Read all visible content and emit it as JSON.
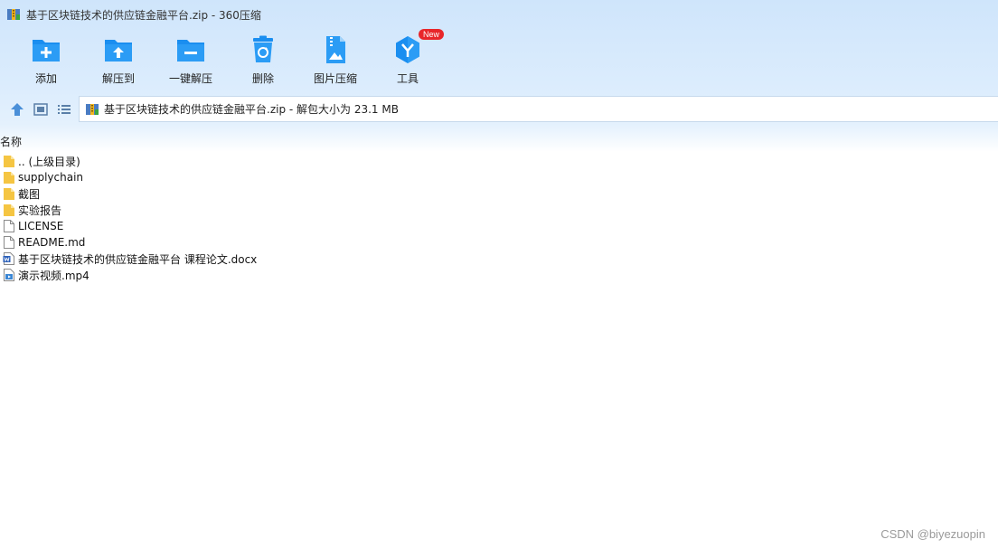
{
  "window": {
    "title": "基于区块链技术的供应链金融平台.zip - 360压缩"
  },
  "toolbar": {
    "items": [
      {
        "id": "add",
        "label": "添加",
        "icon": "folder-plus-icon"
      },
      {
        "id": "extract-to",
        "label": "解压到",
        "icon": "folder-upload-icon"
      },
      {
        "id": "one-click-extract",
        "label": "一键解压",
        "icon": "folder-minus-icon"
      },
      {
        "id": "delete",
        "label": "删除",
        "icon": "recycle-bin-icon"
      },
      {
        "id": "image-compress",
        "label": "图片压缩",
        "icon": "image-zip-icon"
      },
      {
        "id": "tools",
        "label": "工具",
        "icon": "hexagon-tools-icon",
        "badge": "New"
      }
    ]
  },
  "pathbar": {
    "text": "基于区块链技术的供应链金融平台.zip - 解包大小为 23.1 MB"
  },
  "list": {
    "column_name": "名称",
    "files": [
      {
        "name": ".. (上级目录)",
        "type": "parent-folder"
      },
      {
        "name": "supplychain",
        "type": "folder"
      },
      {
        "name": "截图",
        "type": "folder"
      },
      {
        "name": "实验报告",
        "type": "folder"
      },
      {
        "name": "LICENSE",
        "type": "file"
      },
      {
        "name": "README.md",
        "type": "file"
      },
      {
        "name": "基于区块链技术的供应链金融平台 课程论文.docx",
        "type": "docx"
      },
      {
        "name": "演示视频.mp4",
        "type": "video"
      }
    ]
  },
  "watermark": "CSDN @biyezuopin",
  "colors": {
    "accent": "#1a8ef0",
    "badge": "#e8262a",
    "folder": "#f5c542"
  }
}
